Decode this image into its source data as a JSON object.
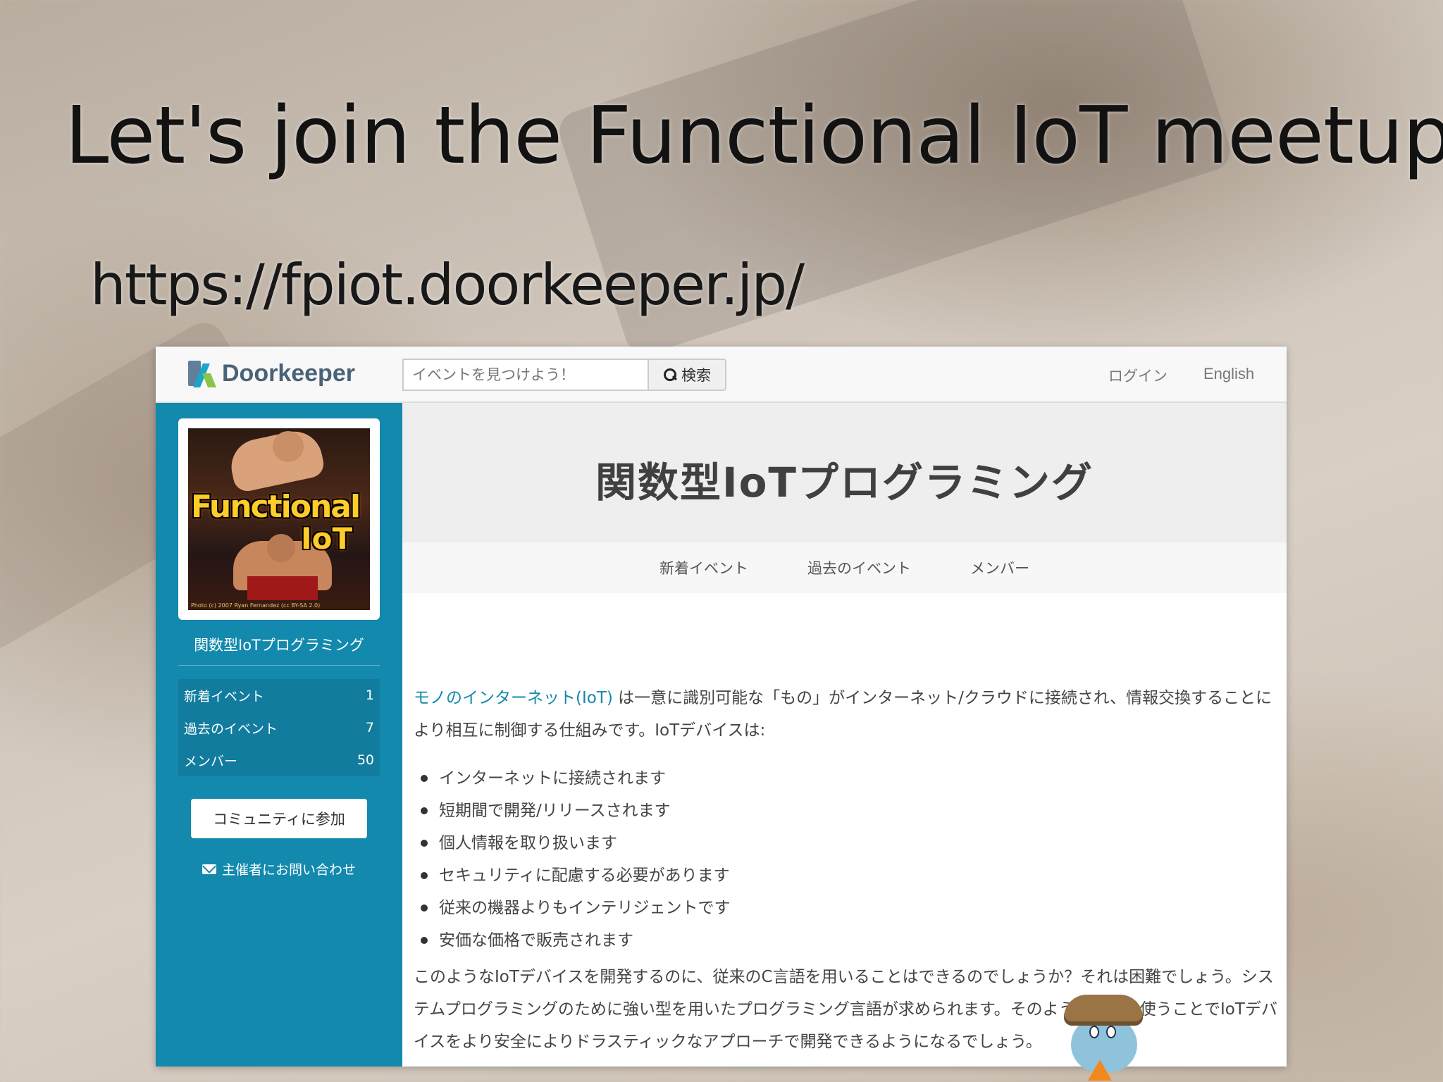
{
  "slide": {
    "title": "Let's join the Functional IoT meetup!",
    "url": "https://fpiot.doorkeeper.jp/"
  },
  "navbar": {
    "logo_text": "Doorkeeper",
    "search_placeholder": "イベントを見つけよう！",
    "search_button": "検索",
    "login": "ログイン",
    "language": "English"
  },
  "sidebar": {
    "image_text_1": "Functional",
    "image_text_2": "IoT",
    "image_credit": "Photo (c) 2007 Ryan Fernandez (cc BY-SA 2.0)",
    "group_name": "関数型IoTプログラミング",
    "items": [
      {
        "label": "新着イベント",
        "count": "1"
      },
      {
        "label": "過去のイベント",
        "count": "7"
      },
      {
        "label": "メンバー",
        "count": "50"
      }
    ],
    "join_button": "コミュニティに参加",
    "contact": "主催者にお問い合わせ"
  },
  "main": {
    "title": "関数型IoTプログラミング",
    "tabs": [
      "新着イベント",
      "過去のイベント",
      "メンバー"
    ],
    "intro_link": "モノのインターネット(IoT)",
    "intro_text": " は一意に識別可能な「もの」がインターネット/クラウドに接続され、情報交換することにより相互に制御する仕組みです。IoTデバイスは:",
    "bullets": [
      "インターネットに接続されます",
      "短期間で開発/リリースされます",
      "個人情報を取り扱います",
      "セキュリティに配慮する必要があります",
      "従来の機器よりもインテリジェントです",
      "安価な価格で販売されます"
    ],
    "closing_text": "このようなIoTデバイスを開発するのに、従来のC言語を用いることはできるのでしょうか？それは困難でしょう。システムプログラミングのために強い型を用いたプログラミング言語が求められます。そのような言語を使うことでIoTデバイスをより安全によりドラスティックなアプローチで開発できるようになるでしょう。"
  },
  "colors": {
    "sidebar": "#1389ad",
    "link": "#1389ad"
  }
}
